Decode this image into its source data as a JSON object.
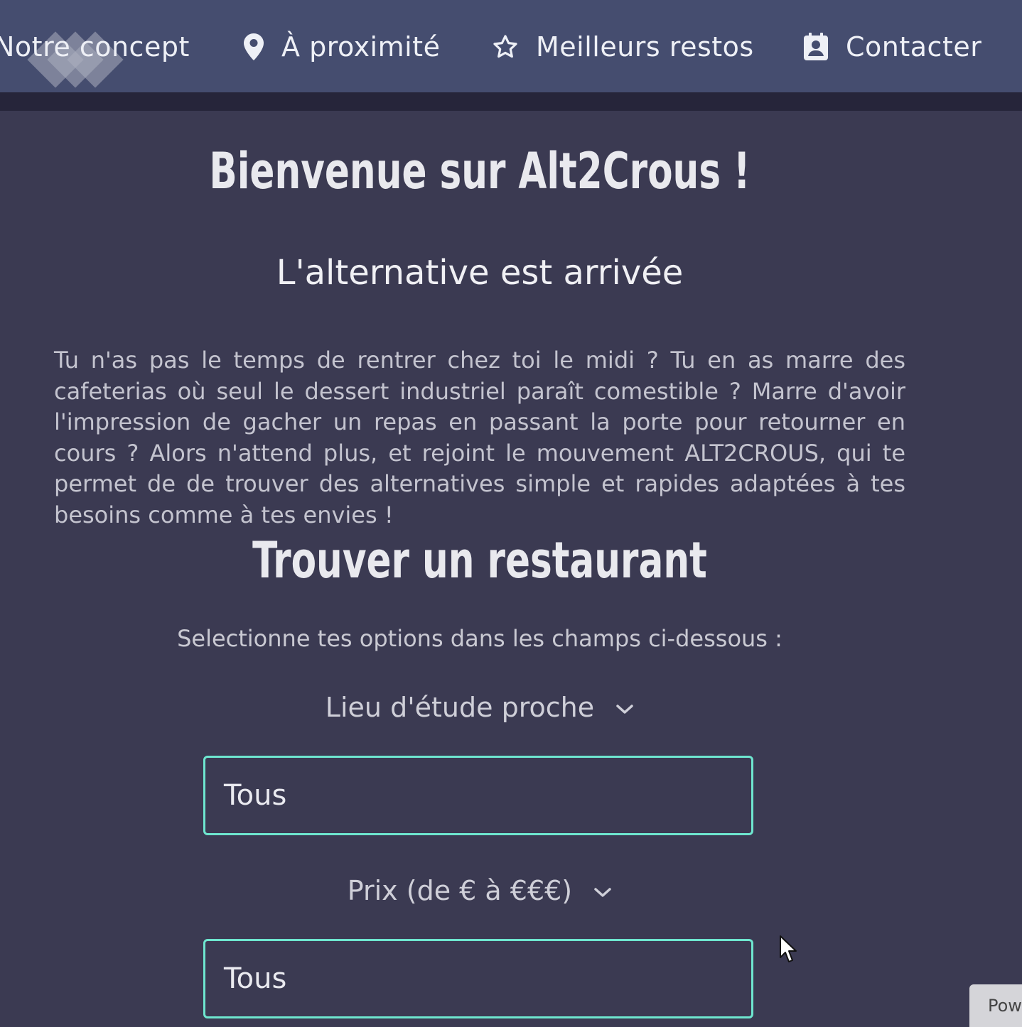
{
  "nav": {
    "items": [
      {
        "label": "Notre concept",
        "icon": "logo-diamonds"
      },
      {
        "label": "À proximité",
        "icon": "map-pin-icon"
      },
      {
        "label": "Meilleurs restos",
        "icon": "star-icon"
      },
      {
        "label": "Contacter",
        "icon": "contact-card-icon"
      }
    ]
  },
  "hero": {
    "title": "Bienvenue sur Alt2Crous !",
    "subtitle": "L'alternative est arrivée",
    "description": "Tu n'as pas le temps de rentrer chez toi le midi ? Tu en as marre des cafeterias où seul le dessert industriel paraît comestible ? Marre d'avoir l'impression de gacher un repas en passant la porte pour retourner en cours ? Alors n'attend plus, et rejoint le mouvement ALT2CROUS, qui te permet de de trouver des alternatives simple et rapides adaptées à tes besoins comme à tes envies !"
  },
  "search": {
    "title": "Trouver un restaurant",
    "prompt": "Selectionne tes options dans les champs ci-dessous :",
    "filters": [
      {
        "label": "Lieu d'étude proche",
        "value": "Tous"
      },
      {
        "label": "Prix (de € à €€€)",
        "value": "Tous"
      }
    ]
  },
  "corner_tab": {
    "label": "Pow"
  },
  "colors": {
    "navbar": "#454d6f",
    "background": "#3b3a52",
    "accent_border": "#6ee6cf"
  }
}
